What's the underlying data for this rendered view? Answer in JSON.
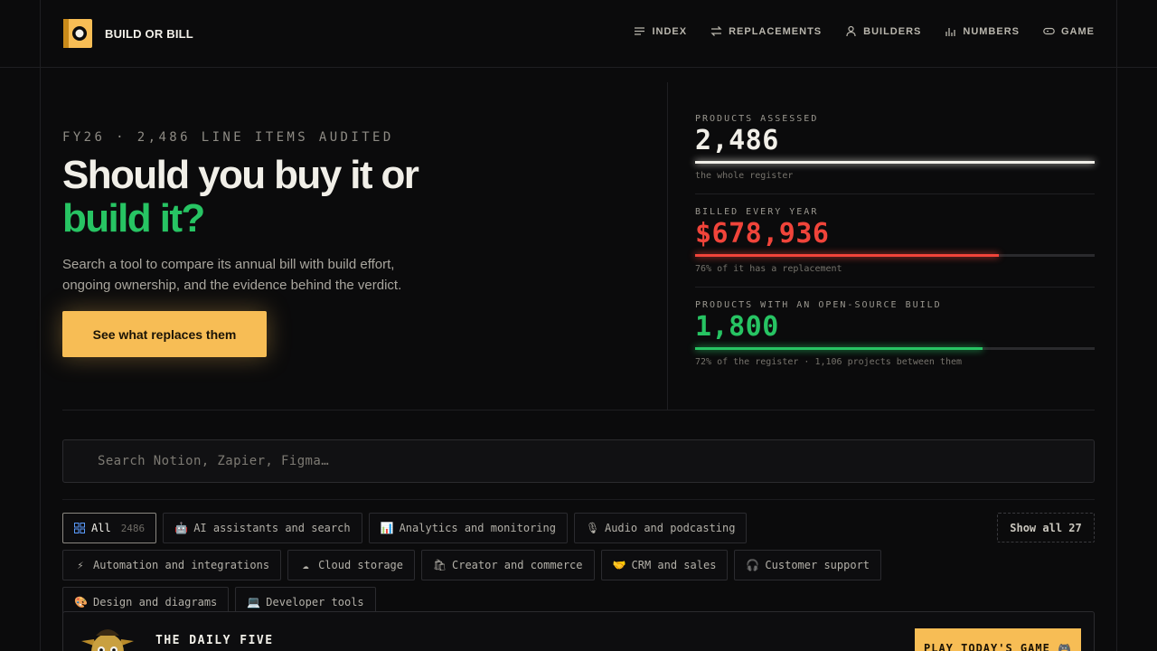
{
  "brand": {
    "name": "BUILD OR BILL",
    "logo_icon": "b-logo-icon",
    "accent": "#f7bd55"
  },
  "nav": [
    {
      "label": "INDEX",
      "icon": "list-icon"
    },
    {
      "label": "REPLACEMENTS",
      "icon": "swap-icon"
    },
    {
      "label": "BUILDERS",
      "icon": "person-icon"
    },
    {
      "label": "NUMBERS",
      "icon": "bar-chart-icon"
    },
    {
      "label": "GAME",
      "icon": "gamepad-icon"
    }
  ],
  "hero": {
    "eyebrow": "FY26 · 2,486 LINE ITEMS AUDITED",
    "title_line1": "Should you buy it or",
    "title_line2": "build it?",
    "lede": "Search a tool to compare its annual bill with build effort, ongoing ownership, and the evidence behind the verdict.",
    "cta": "See what replaces them"
  },
  "stats": [
    {
      "label": "PRODUCTS ASSESSED",
      "value": "2,486",
      "note": "the whole register",
      "fill": 1.0,
      "color": "#f1efe8"
    },
    {
      "label": "BILLED EVERY YEAR",
      "value": "$678,936",
      "note": "76% of it has a replacement",
      "fill": 0.76,
      "color": "#f0443a"
    },
    {
      "label": "PRODUCTS WITH AN OPEN-SOURCE BUILD",
      "value": "1,800",
      "note": "72% of the register · 1,106 projects between them",
      "fill": 0.72,
      "color": "#27c463"
    }
  ],
  "search": {
    "placeholder": "Search Notion, Zapier, Figma…",
    "value": ""
  },
  "categories": [
    {
      "label": "All",
      "count": "2486",
      "emoji": "grid-icon",
      "active": true
    },
    {
      "label": "AI assistants and search",
      "emoji": "🤖"
    },
    {
      "label": "Analytics and monitoring",
      "emoji": "📊"
    },
    {
      "label": "Audio and podcasting",
      "emoji": "🎙"
    },
    {
      "label": "Automation and integrations",
      "emoji": "⚡"
    },
    {
      "label": "Cloud storage",
      "emoji": "☁"
    },
    {
      "label": "Creator and commerce",
      "emoji": "🛍"
    },
    {
      "label": "CRM and sales",
      "emoji": "🤝"
    },
    {
      "label": "Customer support",
      "emoji": "🎧"
    },
    {
      "label": "Design and diagrams",
      "emoji": "🎨"
    },
    {
      "label": "Developer tools",
      "emoji": "💻"
    }
  ],
  "show_all": "Show all 27",
  "daily": {
    "title": "THE DAILY FIVE",
    "button": "PLAY TODAY'S GAME 🎮"
  }
}
